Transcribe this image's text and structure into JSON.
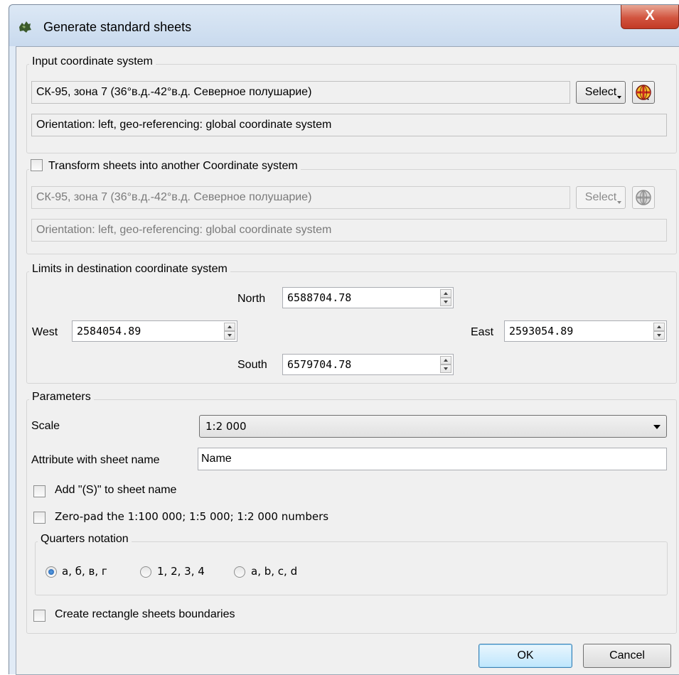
{
  "window": {
    "title": "Generate standard sheets",
    "close_glyph": "X"
  },
  "input_cs": {
    "group_title": "Input coordinate system",
    "name": "СК-95, зона 7 (36°в.д.-42°в.д. Северное полушарие)",
    "select_label": "Select",
    "orientation": "Orientation: left, geo-referencing: global coordinate system"
  },
  "transform": {
    "checkbox_label": "Transform sheets into another Coordinate system",
    "checked": false,
    "name": "СК-95, зона 7 (36°в.д.-42°в.д. Северное полушарие)",
    "select_label": "Select",
    "orientation": "Orientation: left, geo-referencing: global coordinate system"
  },
  "limits": {
    "group_title": "Limits in destination coordinate system",
    "north_label": "North",
    "north_value": "6588704.78",
    "west_label": "West",
    "west_value": "2584054.89",
    "east_label": "East",
    "east_value": "2593054.89",
    "south_label": "South",
    "south_value": "6579704.78"
  },
  "parameters": {
    "group_title": "Parameters",
    "scale_label": "Scale",
    "scale_value": "1:2 000",
    "attr_label": "Attribute with sheet name",
    "attr_value": "Name",
    "add_s_label": "Add \"(S)\" to sheet name",
    "zero_pad_label": "Zero-pad the 1:100 000; 1:5 000; 1:2 000 numbers",
    "quarters_title": "Quarters notation",
    "quarters_options": [
      "а, б, в, г",
      "1, 2, 3, 4",
      "a, b, c, d"
    ],
    "quarters_selected": "а, б, в, г",
    "rect_label": "Create rectangle sheets boundaries"
  },
  "buttons": {
    "ok": "OK",
    "cancel": "Cancel"
  },
  "colors": {
    "accent": "#3c7fb1",
    "close": "#c23a25",
    "globe_red": "#c8281e",
    "globe_yellow": "#f5c22a"
  }
}
